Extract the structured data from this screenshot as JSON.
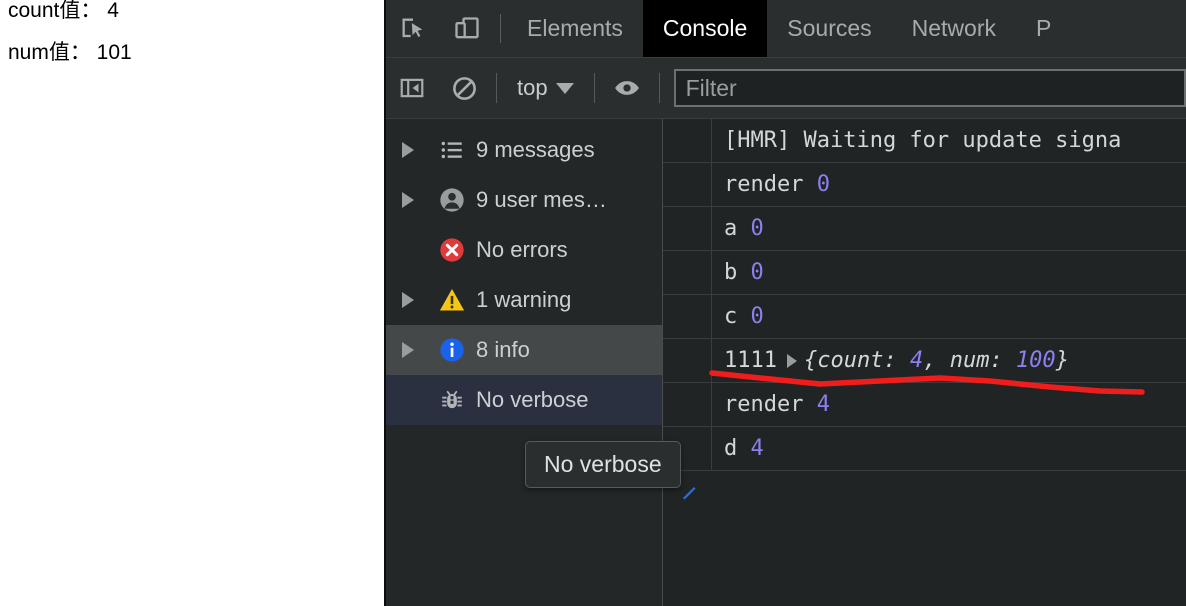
{
  "page": {
    "line1": "count值： 4",
    "line2": "num值： 101"
  },
  "devtools": {
    "tabbar": {
      "inspect_icon": "inspect-element-icon",
      "device_icon": "device-toolbar-icon",
      "tabs": [
        {
          "label": "Elements",
          "active": false
        },
        {
          "label": "Console",
          "active": true
        },
        {
          "label": "Sources",
          "active": false
        },
        {
          "label": "Network",
          "active": false
        },
        {
          "label": "P",
          "active": false
        }
      ]
    },
    "toolbar": {
      "sidebar_toggle_icon": "console-sidebar-toggle-icon",
      "clear_icon": "clear-console-icon",
      "context_label": "top",
      "eye_icon": "live-expression-eye-icon",
      "filter_placeholder": "Filter",
      "filter_value": ""
    },
    "sidebar": {
      "items": [
        {
          "label": "9 messages",
          "icon": "list-icon",
          "arrow": true,
          "state": "normal"
        },
        {
          "label": "9 user mes…",
          "icon": "user-icon",
          "arrow": true,
          "state": "normal"
        },
        {
          "label": "No errors",
          "icon": "error-icon",
          "arrow": false,
          "state": "normal"
        },
        {
          "label": "1 warning",
          "icon": "warning-icon",
          "arrow": true,
          "state": "normal"
        },
        {
          "label": "8 info",
          "icon": "info-icon",
          "arrow": true,
          "state": "hovered"
        },
        {
          "label": "No verbose",
          "icon": "bug-icon",
          "arrow": false,
          "state": "selected"
        }
      ]
    },
    "console": {
      "messages": [
        {
          "text": "[HMR] Waiting for update signa",
          "value": "",
          "object": ""
        },
        {
          "text": "render ",
          "value": "0",
          "object": ""
        },
        {
          "text": "a ",
          "value": "0",
          "object": ""
        },
        {
          "text": "b ",
          "value": "0",
          "object": ""
        },
        {
          "text": "c ",
          "value": "0",
          "object": ""
        },
        {
          "text": "1111",
          "value": "",
          "object": "{count: 4, num: 100}"
        },
        {
          "text": "render ",
          "value": "4",
          "object": ""
        },
        {
          "text": "d ",
          "value": "4",
          "object": ""
        }
      ],
      "object_row": {
        "prefix": "1111",
        "open_brace": "{",
        "key1": "count: ",
        "val1": "4",
        "sep": ", ",
        "key2": "num: ",
        "val2": "100",
        "close_brace": "}"
      }
    },
    "tooltip": {
      "text": "No verbose"
    }
  },
  "annotation": {
    "color": "#f01d1d",
    "shape": "hand-drawn-underline"
  },
  "colors": {
    "panel_bg": "#242728",
    "toolbar_bg": "#2b2e2f",
    "console_bg": "#212425",
    "active_tab_bg": "#000000",
    "selected_row": "#2a3040",
    "hover_row": "#454849",
    "number_purple": "#8d7ff0",
    "error_red": "#e03a3a",
    "warning_yellow": "#f5c518",
    "info_blue": "#1a63e8",
    "annotation_red": "#f01d1d"
  }
}
